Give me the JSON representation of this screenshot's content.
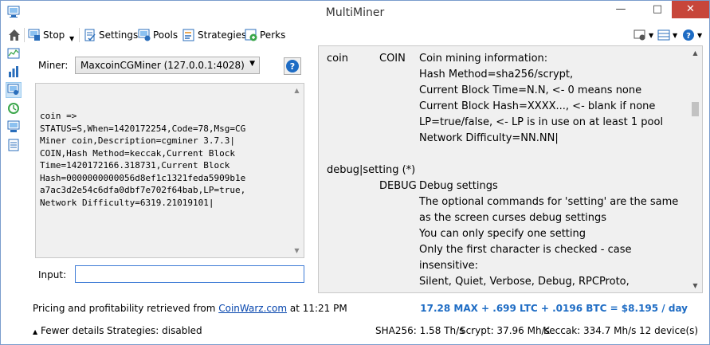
{
  "window": {
    "title": "MultiMiner",
    "minimize": "—",
    "maximize": "□",
    "close": "✕"
  },
  "toolbar": {
    "stop_label": "Stop",
    "settings_label": "Settings",
    "pools_label": "Pools",
    "strategies_label": "Strategies",
    "perks_label": "Perks",
    "dropdown_glyph": "▼"
  },
  "miner": {
    "label": "Miner:",
    "selected": "MaxcoinCGMiner (127.0.0.1:4028)",
    "help": "?"
  },
  "output": {
    "lines": [
      "coin =>",
      "STATUS=S,When=1420172254,Code=78,Msg=CG",
      "Miner coin,Description=cgminer 3.7.3|",
      "COIN,Hash Method=keccak,Current Block",
      "Time=1420172166.318731,Current Block",
      "Hash=0000000000056d8ef1c1321feda5909b1e",
      "a7ac3d2e54c6dfa0dbf7e702f64bab,LP=true,",
      "Network Difficulty=6319.21019101|"
    ]
  },
  "input": {
    "label": "Input:",
    "value": ""
  },
  "help_panel": {
    "lines": [
      {
        "c1": "coin",
        "c2": "COIN",
        "c3": "Coin mining information:"
      },
      {
        "c1": "",
        "c2": "",
        "c3": "Hash Method=sha256/scrypt,"
      },
      {
        "c1": "",
        "c2": "",
        "c3": "Current Block Time=N.N, <- 0 means none"
      },
      {
        "c1": "",
        "c2": "",
        "c3": "Current Block Hash=XXXX..., <- blank if none"
      },
      {
        "c1": "",
        "c2": "",
        "c3": "LP=true/false, <- LP is in use on at least 1 pool"
      },
      {
        "c1": "",
        "c2": "",
        "c3": "Network Difficulty=NN.NN|"
      },
      {
        "c1": "",
        "c2": "",
        "c3": ""
      },
      {
        "c1": "debug|setting (*)",
        "c2": "",
        "c3": ""
      },
      {
        "c1": "",
        "c2": "DEBUG",
        "c3": "Debug settings"
      },
      {
        "c1": "",
        "c2": "",
        "c3": "The optional commands for 'setting' are the same"
      },
      {
        "c1": "",
        "c2": "",
        "c3": "as the screen curses debug settings"
      },
      {
        "c1": "",
        "c2": "",
        "c3": "You can only specify one setting"
      },
      {
        "c1": "",
        "c2": "",
        "c3": "Only the first character is checked - case"
      },
      {
        "c1": "",
        "c2": "",
        "c3": "insensitive:"
      },
      {
        "c1": "",
        "c2": "",
        "c3": "Silent, Quiet, Verbose, Debug, RPCProto,"
      }
    ]
  },
  "pricing": {
    "prefix": "Pricing and profitability retrieved from",
    "link": "CoinWarz.com",
    "suffix": "at 11:21 PM"
  },
  "profit": "17.28 MAX + .699 LTC + .0196 BTC = $8.195 / day",
  "status": {
    "details_toggle": "Fewer details",
    "details_glyph": "▲",
    "strategies": "Strategies: disabled",
    "sha256": "SHA256: 1.58 Th/s",
    "scrypt": "Scrypt: 37.96 Mh/s",
    "keccak": "Keccak: 334.7 Mh/s",
    "devices": "12 device(s)"
  },
  "colors": {
    "accent_blue": "#1e6cc4",
    "link": "#0645ad",
    "close_red": "#c7463a"
  },
  "icons": [
    "home-icon",
    "stop-icon",
    "settings-icon",
    "pools-icon",
    "strategies-icon",
    "perks-icon",
    "view-icon",
    "columns-icon",
    "help-icon",
    "chart-line-icon",
    "bar-chart-icon",
    "api-console-icon",
    "history-icon",
    "network-icon",
    "log-icon"
  ]
}
